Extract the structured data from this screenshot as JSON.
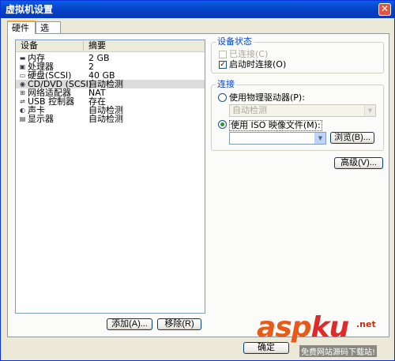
{
  "window": {
    "title": "虚拟机设置",
    "close_glyph": "✕"
  },
  "tabs": [
    {
      "label": "硬件",
      "active": true
    },
    {
      "label": "选项",
      "active": false
    }
  ],
  "device_list": {
    "columns": [
      "设备",
      "摘要"
    ],
    "rows": [
      {
        "icon": "memory-icon",
        "glyph": "▬",
        "device": "内存",
        "summary": "2 GB",
        "selected": false
      },
      {
        "icon": "processor-icon",
        "glyph": "▣",
        "device": "处理器",
        "summary": "2",
        "selected": false
      },
      {
        "icon": "hard-disk-icon",
        "glyph": "▭",
        "device": "硬盘(SCSI)",
        "summary": "40 GB",
        "selected": false
      },
      {
        "icon": "cd-dvd-icon",
        "glyph": "◉",
        "device": "CD/DVD (SCSI)",
        "summary": "自动检测",
        "selected": true
      },
      {
        "icon": "network-adapter-icon",
        "glyph": "⊞",
        "device": "网络适配器",
        "summary": "NAT",
        "selected": false
      },
      {
        "icon": "usb-icon",
        "glyph": "⇌",
        "device": "USB 控制器",
        "summary": "存在",
        "selected": false
      },
      {
        "icon": "sound-card-icon",
        "glyph": "◐",
        "device": "声卡",
        "summary": "自动检测",
        "selected": false
      },
      {
        "icon": "display-icon",
        "glyph": "▤",
        "device": "显示器",
        "summary": "自动检测",
        "selected": false
      }
    ]
  },
  "buttons": {
    "add": "添加(A)...",
    "remove": "移除(R)",
    "browse": "浏览(B)...",
    "advanced": "高级(V)...",
    "ok": "确定"
  },
  "device_status": {
    "title": "设备状态",
    "connected": {
      "label": "已连接(C)",
      "checked": false,
      "disabled": true
    },
    "connect_at_power_on": {
      "label": "启动时连接(O)",
      "checked": true
    }
  },
  "connection": {
    "title": "连接",
    "physical_drive": {
      "label": "使用物理驱动器(P):",
      "selected": false
    },
    "physical_drive_value": "自动检测",
    "iso_image": {
      "label": "使用 ISO 映像文件(M):",
      "selected": true
    },
    "iso_path": ""
  },
  "watermark": {
    "brand": "asp",
    "brand_accent": "ku",
    "tld": ".net",
    "slogan": "免费网站源码下载站!"
  },
  "colors": {
    "title_bar": "#0844c8",
    "group_title": "#0046d5",
    "selected_row": "#dcdcdc",
    "watermark": "#e85a18"
  }
}
